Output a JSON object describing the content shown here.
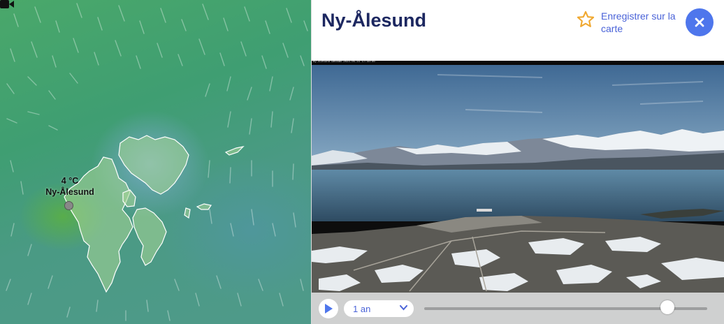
{
  "map": {
    "temperature": "4 °C",
    "station_name": "Ny-Ålesund",
    "icons": [
      "station-dot",
      "webcam-icon"
    ]
  },
  "panel": {
    "title": "Ny-Ålesund",
    "save_label": "Enregistrer sur la carte",
    "close_icon": "close-icon",
    "webcam_overlay": "Ny-Ålesund webcam 2023-05-15 17:40:00",
    "controls": {
      "period_label": "1 an",
      "timeline_position_fraction": 0.86
    }
  },
  "colors": {
    "title": "#1c2760",
    "accent": "#4a63d8",
    "close_button": "#4e76ec",
    "star": "#f0a830"
  }
}
